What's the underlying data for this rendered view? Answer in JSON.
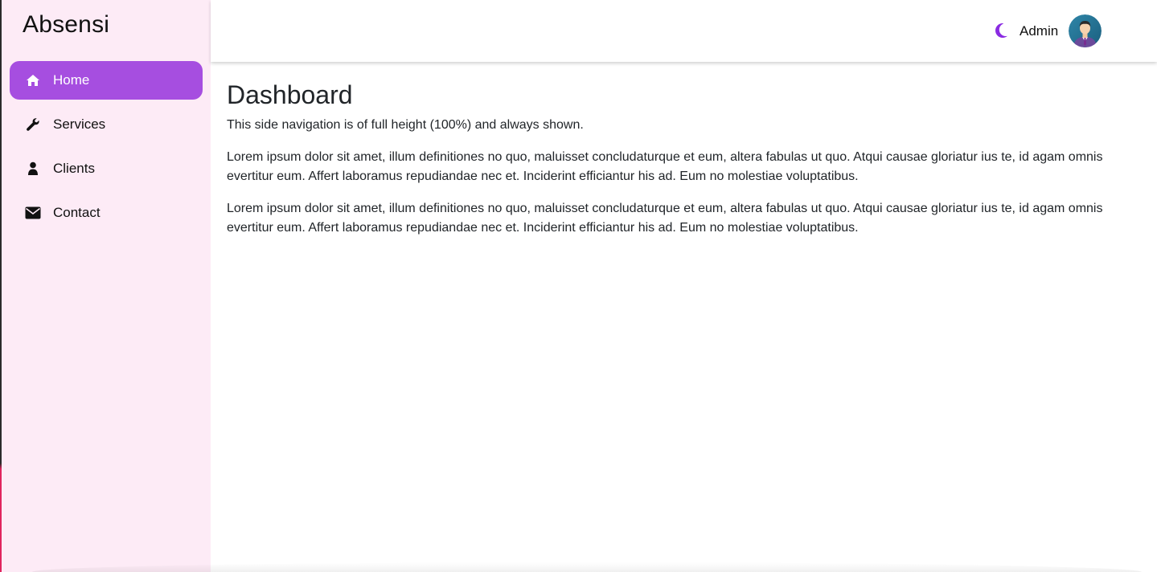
{
  "sidebar": {
    "brand": "Absensi",
    "items": [
      {
        "label": "Home",
        "icon": "home-icon",
        "active": true
      },
      {
        "label": "Services",
        "icon": "wrench-icon",
        "active": false
      },
      {
        "label": "Clients",
        "icon": "user-icon",
        "active": false
      },
      {
        "label": "Contact",
        "icon": "envelope-icon",
        "active": false
      }
    ]
  },
  "header": {
    "theme_icon": "moon-icon",
    "user_name": "Admin",
    "avatar_icon": "avatar-icon"
  },
  "main": {
    "title": "Dashboard",
    "intro": "This side navigation is of full height (100%) and always shown.",
    "paragraphs": [
      "Lorem ipsum dolor sit amet, illum definitiones no quo, maluisset concludaturque et eum, altera fabulas ut quo. Atqui causae gloriatur ius te, id agam omnis evertitur eum. Affert laboramus repudiandae nec et. Inciderint efficiantur his ad. Eum no molestiae voluptatibus.",
      "Lorem ipsum dolor sit amet, illum definitiones no quo, maluisset concludaturque et eum, altera fabulas ut quo. Atqui causae gloriatur ius te, id agam omnis evertitur eum. Affert laboramus repudiandae nec et. Inciderint efficiantur his ad. Eum no molestiae voluptatibus."
    ]
  },
  "colors": {
    "accent": "#a64ee0",
    "sidebar_bg": "#fdebf6",
    "moon": "#8a2be2"
  }
}
